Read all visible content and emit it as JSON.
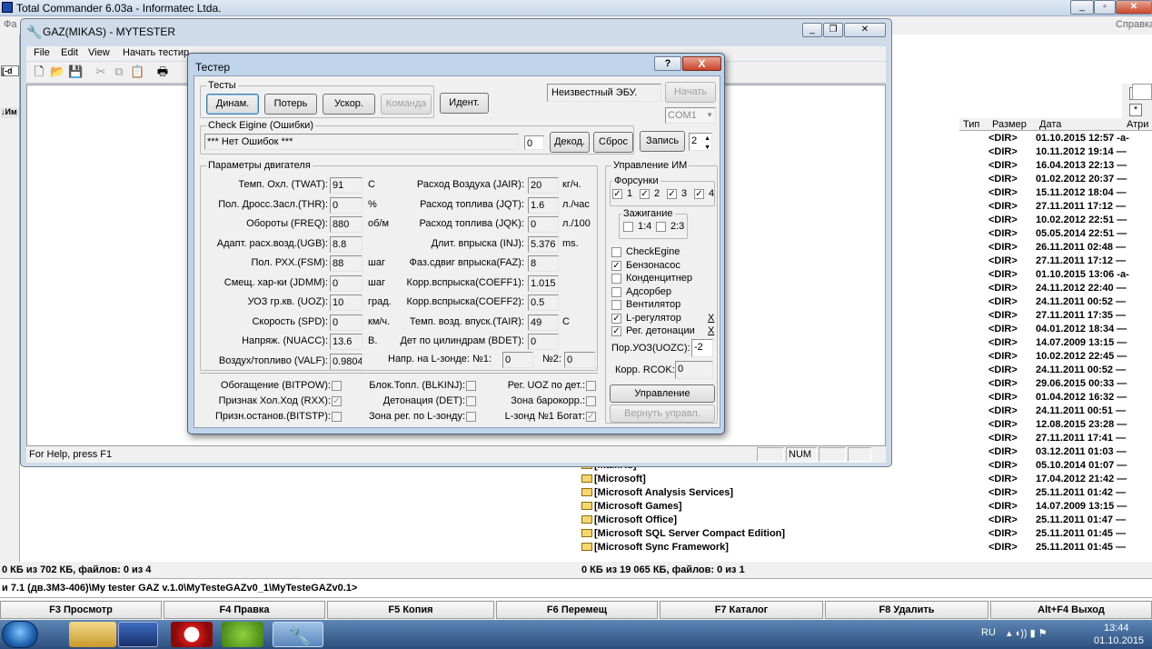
{
  "tc": {
    "title": "Total Commander 6.03a - Informatec Ltda.",
    "menu_first": "Фа",
    "menu_last": "Справка",
    "right_header": {
      "type": "Тип",
      "size": "Размер",
      "date": "Дата",
      "attr": "Атри"
    },
    "right_rows": [
      {
        "name": "",
        "size": "<DIR>",
        "date": "01.10.2015 12:57 -а-"
      },
      {
        "name": "",
        "size": "<DIR>",
        "date": "10.11.2012 19:14 —"
      },
      {
        "name": "",
        "size": "<DIR>",
        "date": "16.04.2013 22:13 —"
      },
      {
        "name": "",
        "size": "<DIR>",
        "date": "01.02.2012 20:37 —"
      },
      {
        "name": "",
        "size": "<DIR>",
        "date": "15.11.2012 18:04 —"
      },
      {
        "name": "",
        "size": "<DIR>",
        "date": "27.11.2011 17:12 —"
      },
      {
        "name": "",
        "size": "<DIR>",
        "date": "10.02.2012 22:51 —"
      },
      {
        "name": "",
        "size": "<DIR>",
        "date": "05.05.2014 22:51 —"
      },
      {
        "name": "",
        "size": "<DIR>",
        "date": "26.11.2011 02:48 —"
      },
      {
        "name": "",
        "size": "<DIR>",
        "date": "27.11.2011 17:12 —"
      },
      {
        "name": "",
        "size": "<DIR>",
        "date": "01.10.2015 13:06 -а-"
      },
      {
        "name": "",
        "size": "<DIR>",
        "date": "24.11.2012 22:40 —"
      },
      {
        "name": "",
        "size": "<DIR>",
        "date": "24.11.2011 00:52 —"
      },
      {
        "name": "",
        "size": "<DIR>",
        "date": "27.11.2011 17:35 —"
      },
      {
        "name": "",
        "size": "<DIR>",
        "date": "04.01.2012 18:34 —"
      },
      {
        "name": "",
        "size": "<DIR>",
        "date": "14.07.2009 13:15 —"
      },
      {
        "name": "",
        "size": "<DIR>",
        "date": "10.02.2012 22:45 —"
      },
      {
        "name": "",
        "size": "<DIR>",
        "date": "24.11.2011 00:52 —"
      },
      {
        "name": "",
        "size": "<DIR>",
        "date": "29.06.2015 00:33 —"
      },
      {
        "name": "",
        "size": "<DIR>",
        "date": "01.04.2012 16:32 —"
      },
      {
        "name": "",
        "size": "<DIR>",
        "date": "24.11.2011 00:51 —"
      },
      {
        "name": "",
        "size": "<DIR>",
        "date": "12.08.2015 23:28 —"
      },
      {
        "name": "",
        "size": "<DIR>",
        "date": "27.11.2011 17:41 —"
      },
      {
        "name": "",
        "size": "<DIR>",
        "date": "03.12.2011 01:03 —"
      },
      {
        "name": "[Mail.Ru]",
        "size": "<DIR>",
        "date": "05.10.2014 01:07 —"
      },
      {
        "name": "[Microsoft]",
        "size": "<DIR>",
        "date": "17.04.2012 21:42 —"
      },
      {
        "name": "[Microsoft Analysis Services]",
        "size": "<DIR>",
        "date": "25.11.2011 01:42 —"
      },
      {
        "name": "[Microsoft Games]",
        "size": "<DIR>",
        "date": "14.07.2009 13:15 —"
      },
      {
        "name": "[Microsoft Office]",
        "size": "<DIR>",
        "date": "25.11.2011 01:47 —"
      },
      {
        "name": "[Microsoft SQL Server Compact Edition]",
        "size": "<DIR>",
        "date": "25.11.2011 01:45 —"
      },
      {
        "name": "[Microsoft Sync Framework]",
        "size": "<DIR>",
        "date": "25.11.2011 01:45 —"
      }
    ],
    "status_left": "0 КБ из 702 КБ, файлов: 0 из 4",
    "status_right": "0 КБ из 19 065 КБ, файлов: 0 из 1",
    "cmdline": "и 7.1 (дв.3М3-406)\\My tester GAZ v.1.0\\MyTesteGAZv0_1\\MyTesteGAZv0.1>",
    "fkeys": [
      "F3 Просмотр",
      "F4 Правка",
      "F5 Копия",
      "F6 Перемещ",
      "F7 Каталог",
      "F8 Удалить",
      "Alt+F4 Выход"
    ]
  },
  "taskbar": {
    "lang": "RU",
    "time": "13:44",
    "date": "01.10.2015"
  },
  "mytester": {
    "title": "GAZ(MIKAS) - MYTESTER",
    "menu": [
      "File",
      "Edit",
      "View",
      "Начать тестир"
    ],
    "status": "For Help, press F1",
    "num": "NUM"
  },
  "tester": {
    "title": "Тестер",
    "help": "?",
    "close": "X",
    "tests_label": "Тесты",
    "tests": [
      "Динам.",
      "Потерь",
      "Ускор.",
      "Команда",
      "Идент."
    ],
    "ecu": "Неизвестный ЭБУ.",
    "start": "Начать",
    "com": "COM1",
    "check_label": "Check Eigine (Ошибки)",
    "errors": "*** Нет Ошибок ***",
    "err_count": "0",
    "decode": "Декод.",
    "reset": "Сброс",
    "record": "Запись",
    "record_n": "2",
    "params_label": "Параметры двигателя",
    "left_params": [
      {
        "label": "Темп. Охл. (TWAT):",
        "value": "91",
        "unit": "C"
      },
      {
        "label": "Пол. Дросс.Засл.(THR):",
        "value": "0",
        "unit": "%"
      },
      {
        "label": "Обороты (FREQ):",
        "value": "880",
        "unit": "об/м"
      },
      {
        "label": "Адапт. расх.возд.(UGB):",
        "value": "8.8",
        "unit": ""
      },
      {
        "label": "Пол. РХХ.(FSM):",
        "value": "88",
        "unit": "шаг"
      },
      {
        "label": "Смещ. хар-ки (JDMM):",
        "value": "0",
        "unit": "шаг"
      },
      {
        "label": "УОЗ гр.кв. (UOZ):",
        "value": "10",
        "unit": "град."
      },
      {
        "label": "Скорость (SPD):",
        "value": "0",
        "unit": "км/ч."
      },
      {
        "label": "Напряж. (NUACC):",
        "value": "13.6",
        "unit": "В."
      },
      {
        "label": "Воздух/топливо (VALF):",
        "value": "0.9804",
        "unit": ""
      }
    ],
    "right_params": [
      {
        "label": "Расход Воздуха (JAIR):",
        "value": "20",
        "unit": "кг/ч."
      },
      {
        "label": "Расход топлива (JQT):",
        "value": "1.6",
        "unit": "л./час"
      },
      {
        "label": "Расход топлива (JQK):",
        "value": "0",
        "unit": "л./100"
      },
      {
        "label": "Длит. впрыска (INJ):",
        "value": "5.376",
        "unit": "ms."
      },
      {
        "label": "Фаз.сдвиг впрыска(FAZ):",
        "value": "8",
        "unit": ""
      },
      {
        "label": "Корр.вспрыска(COEFF1):",
        "value": "1.015",
        "unit": ""
      },
      {
        "label": "Корр.вспрыска(COEFF2):",
        "value": "0.5",
        "unit": ""
      },
      {
        "label": "Темп. возд. впуск.(TAIR):",
        "value": "49",
        "unit": "C"
      },
      {
        "label": "Дет по цилиндрам (BDET):",
        "value": "0",
        "unit": ""
      }
    ],
    "lambda_label": "Напр. на L-зонде: №1:",
    "lambda1": "0",
    "lambda2_label": "№2:",
    "lambda2": "0",
    "flags": [
      {
        "label": "Обогащение (BITPOW):",
        "checked": false
      },
      {
        "label": "Блок.Топл. (BLKINJ):",
        "checked": false
      },
      {
        "label": "Рег. UOZ по дет.:",
        "checked": false
      },
      {
        "label": "Признак Хол.Ход (RXX):",
        "checked": true
      },
      {
        "label": "Детонация (DET):",
        "checked": false
      },
      {
        "label": "Зона барокорр.:",
        "checked": false
      },
      {
        "label": "Призн.останов.(BITSTP):",
        "checked": false
      },
      {
        "label": "Зона рег. по L-зонду:",
        "checked": false
      },
      {
        "label": "L-зонд №1 Богат:",
        "checked": true
      }
    ],
    "im_label": "Управление ИМ",
    "injectors_label": "Форсунки",
    "injectors": [
      "1",
      "2",
      "3",
      "4"
    ],
    "ignition_label": "Зажигание",
    "ignition": [
      "1:4",
      "2:3"
    ],
    "im_items": [
      {
        "label": "CheckEgine",
        "checked": false
      },
      {
        "label": "Бензонасос",
        "checked": true
      },
      {
        "label": "Конденцитнер",
        "checked": false
      },
      {
        "label": "Адсорбер",
        "checked": false
      },
      {
        "label": "Вентилятор",
        "checked": false
      },
      {
        "label": "L-регулятор",
        "checked": true
      },
      {
        "label": "Рег. детонации",
        "checked": true
      }
    ],
    "x": "X",
    "uozc_label": "Пор.УОЗ(UOZC):",
    "uozc": "-2",
    "rcok_label": "Корр. RCOK:",
    "rcok": "0",
    "control": "Управление",
    "return": "Вернуть управл."
  }
}
